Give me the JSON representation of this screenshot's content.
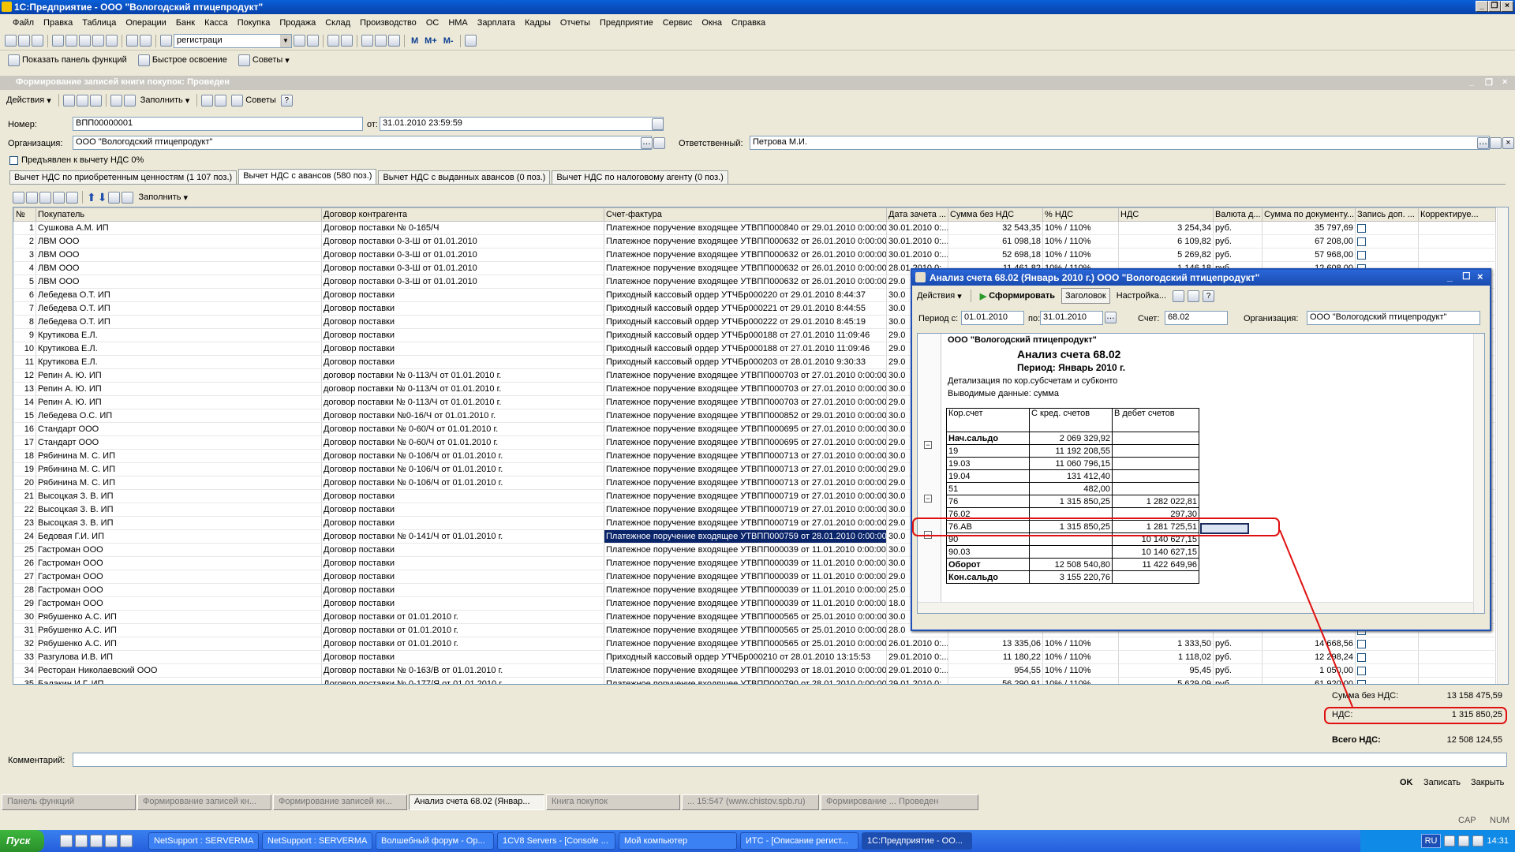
{
  "app": {
    "title": "1С:Предприятие - ООО \"Вологодский птицепродукт\""
  },
  "menu": [
    "Файл",
    "Правка",
    "Таблица",
    "Операции",
    "Банк",
    "Касса",
    "Покупка",
    "Продажа",
    "Склад",
    "Производство",
    "ОС",
    "НМА",
    "Зарплата",
    "Кадры",
    "Отчеты",
    "Предприятие",
    "Сервис",
    "Окна",
    "Справка"
  ],
  "toolbar": {
    "search_value": "регистраци"
  },
  "toolbar2": {
    "panel": "Показать панель функций",
    "quick": "Быстрое освоение",
    "tips": "Советы"
  },
  "doc": {
    "title": "Формирование записей книги покупок: Проведен",
    "actions": "Действия",
    "fill": "Заполнить",
    "tips": "Советы",
    "number_label": "Номер:",
    "number": "ВПП00000001",
    "date_label": "от:",
    "date": "31.01.2010 23:59:59",
    "org_label": "Организация:",
    "org": "ООО \"Вологодский птицепродукт\"",
    "resp_label": "Ответственный:",
    "resp": "Петрова М.И.",
    "checkbox_label": "Предъявлен к вычету НДС 0%",
    "tabs": [
      "Вычет НДС по приобретенным ценностям (1 107 поз.)",
      "Вычет НДС с авансов (580 поз.)",
      "Вычет НДС с выданных авансов (0 поз.)",
      "Вычет НДС по налоговому агенту (0 поз.)"
    ],
    "tab_fill": "Заполнить",
    "columns": [
      "№",
      "Покупатель",
      "Договор контрагента",
      "Счет-фактура",
      "Дата зачета ...",
      "Сумма без НДС",
      "% НДС",
      "НДС",
      "Валюта д...",
      "Сумма по документу...",
      "Запись доп. ...",
      "Корректируе..."
    ],
    "rows": [
      [
        "1",
        "Сушкова А.М. ИП",
        "Договор поставки № 0-165/Ч",
        "Платежное поручение входящее УТВПП000840 от 29.01.2010 0:00:00",
        "30.01.2010 0:...",
        "32 543,35",
        "10% / 110%",
        "3 254,34",
        "руб.",
        "35 797,69"
      ],
      [
        "2",
        "ЛВМ ООО",
        "Договор поставки 0-3-Ш от 01.01.2010",
        "Платежное поручение входящее УТВПП000632 от 26.01.2010 0:00:00",
        "30.01.2010 0:...",
        "61 098,18",
        "10% / 110%",
        "6 109,82",
        "руб.",
        "67 208,00"
      ],
      [
        "3",
        "ЛВМ ООО",
        "Договор поставки 0-3-Ш от 01.01.2010",
        "Платежное поручение входящее УТВПП000632 от 26.01.2010 0:00:00",
        "30.01.2010 0:...",
        "52 698,18",
        "10% / 110%",
        "5 269,82",
        "руб.",
        "57 968,00"
      ],
      [
        "4",
        "ЛВМ ООО",
        "Договор поставки 0-3-Ш от 01.01.2010",
        "Платежное поручение входящее УТВПП000632 от 26.01.2010 0:00:00",
        "28.01.2010 0:...",
        "11 461,82",
        "10% / 110%",
        "1 146,18",
        "руб.",
        "12 608,00"
      ],
      [
        "5",
        "ЛВМ ООО",
        "Договор поставки 0-3-Ш от 01.01.2010",
        "Платежное поручение входящее УТВПП000632 от 26.01.2010 0:00:00",
        "29.0",
        "",
        "",
        "",
        "",
        ""
      ],
      [
        "6",
        "Лебедева О.Т. ИП",
        "Договор поставки",
        "Приходный кассовый ордер УТЧБр000220 от 29.01.2010 8:44:37",
        "30.0",
        "",
        "",
        "",
        "",
        ""
      ],
      [
        "7",
        "Лебедева О.Т. ИП",
        "Договор поставки",
        "Приходный кассовый ордер УТЧБр000221 от 29.01.2010 8:44:55",
        "30.0",
        "",
        "",
        "",
        "",
        ""
      ],
      [
        "8",
        "Лебедева О.Т. ИП",
        "Договор поставки",
        "Приходный кассовый ордер УТЧБр000222 от 29.01.2010 8:45:19",
        "30.0",
        "",
        "",
        "",
        "",
        ""
      ],
      [
        "9",
        "Крутикова Е.Л.",
        "Договор поставки",
        "Приходный кассовый ордер УТЧБр000188 от 27.01.2010 11:09:46",
        "29.0",
        "",
        "",
        "",
        "",
        ""
      ],
      [
        "10",
        "Крутикова Е.Л.",
        "Договор поставки",
        "Приходный кассовый ордер УТЧБр000188 от 27.01.2010 11:09:46",
        "29.0",
        "",
        "",
        "",
        "",
        ""
      ],
      [
        "11",
        "Крутикова Е.Л.",
        "Договор поставки",
        "Приходный кассовый ордер УТЧБр000203 от 28.01.2010 9:30:33",
        "29.0",
        "",
        "",
        "",
        "",
        ""
      ],
      [
        "12",
        "Репин А. Ю. ИП",
        "договор поставки № 0-113/Ч от 01.01.2010 г.",
        "Платежное поручение входящее УТВПП000703 от 27.01.2010 0:00:00",
        "30.0",
        "",
        "",
        "",
        "",
        ""
      ],
      [
        "13",
        "Репин А. Ю. ИП",
        "договор поставки № 0-113/Ч от 01.01.2010 г.",
        "Платежное поручение входящее УТВПП000703 от 27.01.2010 0:00:00",
        "30.0",
        "",
        "",
        "",
        "",
        ""
      ],
      [
        "14",
        "Репин А. Ю. ИП",
        "договор поставки № 0-113/Ч от 01.01.2010 г.",
        "Платежное поручение входящее УТВПП000703 от 27.01.2010 0:00:00",
        "29.0",
        "",
        "",
        "",
        "",
        ""
      ],
      [
        "15",
        "Лебедева О.С. ИП",
        "Договор поставки №0-16/Ч от 01.01.2010 г.",
        "Платежное поручение входящее УТВПП000852 от 29.01.2010 0:00:00",
        "30.0",
        "",
        "",
        "",
        "",
        ""
      ],
      [
        "16",
        "Стандарт ООО",
        "Договор поставки № 0-60/Ч от 01.01.2010 г.",
        "Платежное поручение входящее УТВПП000695 от 27.01.2010 0:00:00",
        "30.0",
        "",
        "",
        "",
        "",
        ""
      ],
      [
        "17",
        "Стандарт ООО",
        "Договор поставки № 0-60/Ч от 01.01.2010 г.",
        "Платежное поручение входящее УТВПП000695 от 27.01.2010 0:00:00",
        "29.0",
        "",
        "",
        "",
        "",
        ""
      ],
      [
        "18",
        "Рябинина М. С. ИП",
        "Договор поставки № 0-106/Ч от 01.01.2010 г.",
        "Платежное поручение входящее УТВПП000713 от 27.01.2010 0:00:00",
        "30.0",
        "",
        "",
        "",
        "",
        ""
      ],
      [
        "19",
        "Рябинина М. С. ИП",
        "Договор поставки № 0-106/Ч от 01.01.2010 г.",
        "Платежное поручение входящее УТВПП000713 от 27.01.2010 0:00:00",
        "29.0",
        "",
        "",
        "",
        "",
        ""
      ],
      [
        "20",
        "Рябинина М. С. ИП",
        "Договор поставки № 0-106/Ч от 01.01.2010 г.",
        "Платежное поручение входящее УТВПП000713 от 27.01.2010 0:00:00",
        "29.0",
        "",
        "",
        "",
        "",
        ""
      ],
      [
        "21",
        "Высоцкая З. В. ИП",
        "Договор поставки",
        "Платежное поручение входящее УТВПП000719 от 27.01.2010 0:00:00",
        "30.0",
        "",
        "",
        "",
        "",
        ""
      ],
      [
        "22",
        "Высоцкая З. В. ИП",
        "Договор поставки",
        "Платежное поручение входящее УТВПП000719 от 27.01.2010 0:00:00",
        "30.0",
        "",
        "",
        "",
        "",
        ""
      ],
      [
        "23",
        "Высоцкая З. В. ИП",
        "Договор поставки",
        "Платежное поручение входящее УТВПП000719 от 27.01.2010 0:00:00",
        "29.0",
        "",
        "",
        "",
        "",
        ""
      ],
      [
        "24",
        "Бедовая Г.И. ИП",
        "Договор поставки № 0-141/Ч от 01.01.2010 г.",
        "Платежное поручение входящее УТВПП000759 от 28.01.2010 0:00:00",
        "30.0",
        "",
        "",
        "",
        "",
        ""
      ],
      [
        "25",
        "Гастроман ООО",
        "Договор поставки",
        "Платежное поручение входящее УТВПП000039 от 11.01.2010 0:00:00",
        "30.0",
        "",
        "",
        "",
        "",
        ""
      ],
      [
        "26",
        "Гастроман ООО",
        "Договор поставки",
        "Платежное поручение входящее УТВПП000039 от 11.01.2010 0:00:00",
        "30.0",
        "",
        "",
        "",
        "",
        ""
      ],
      [
        "27",
        "Гастроман ООО",
        "Договор поставки",
        "Платежное поручение входящее УТВПП000039 от 11.01.2010 0:00:00",
        "29.0",
        "",
        "",
        "",
        "",
        ""
      ],
      [
        "28",
        "Гастроман ООО",
        "Договор поставки",
        "Платежное поручение входящее УТВПП000039 от 11.01.2010 0:00:00",
        "25.0",
        "",
        "",
        "",
        "",
        ""
      ],
      [
        "29",
        "Гастроман ООО",
        "Договор поставки",
        "Платежное поручение входящее УТВПП000039 от 11.01.2010 0:00:00",
        "18.0",
        "",
        "",
        "",
        "",
        ""
      ],
      [
        "30",
        "Рябушенко А.С. ИП",
        "Договор поставки от 01.01.2010 г.",
        "Платежное поручение входящее УТВПП000565 от 25.01.2010 0:00:00",
        "30.0",
        "",
        "",
        "",
        "",
        ""
      ],
      [
        "31",
        "Рябушенко А.С. ИП",
        "Договор поставки от 01.01.2010 г.",
        "Платежное поручение входящее УТВПП000565 от 25.01.2010 0:00:00",
        "28.0",
        "",
        "",
        "",
        "",
        ""
      ],
      [
        "32",
        "Рябушенко А.С. ИП",
        "Договор поставки от 01.01.2010 г.",
        "Платежное поручение входящее УТВПП000565 от 25.01.2010 0:00:00",
        "26.01.2010 0:...",
        "13 335,06",
        "10% / 110%",
        "1 333,50",
        "руб.",
        "14 668,56"
      ],
      [
        "33",
        "Разгулова И.В. ИП",
        "Договор поставки",
        "Приходный кассовый ордер УТЧБр000210 от 28.01.2010 13:15:53",
        "29.01.2010 0:...",
        "11 180,22",
        "10% / 110%",
        "1 118,02",
        "руб.",
        "12 298,24"
      ],
      [
        "34",
        "Ресторан Николаевский ООО",
        "Договор поставки № 0-163/В от 01.01.2010 г.",
        "Платежное поручение входящее УТВПП000293 от 18.01.2010 0:00:00",
        "29.01.2010 0:...",
        "954,55",
        "10% / 110%",
        "95,45",
        "руб.",
        "1 050,00"
      ],
      [
        "35",
        "Балакин И.Г. ИП",
        "Договор поставки № 0-177/Я от 01.01.2010 г.",
        "Платежное поручение входящее УТВПП000790 от 28.01.2010 0:00:00",
        "29.01.2010 0:...",
        "56 290,91",
        "10% / 110%",
        "5 629,09",
        "руб.",
        "61 920,00"
      ]
    ],
    "summary": {
      "sum_label": "Сумма без НДС:",
      "sum": "13 158 475,59",
      "vat_label": "НДС:",
      "vat": "1 315 850,25",
      "total_label": "Всего НДС:",
      "total": "12 508 124,55"
    },
    "comment_label": "Комментарий:",
    "ok": "OK",
    "save": "Записать",
    "close": "Закрыть"
  },
  "analysis": {
    "title": "Анализ счета 68.02 (Январь 2010 г.) ООО \"Вологодский птицепродукт\"",
    "actions": "Действия",
    "generate": "Сформировать",
    "header_btn": "Заголовок",
    "settings": "Настройка...",
    "period_label": "Период с:",
    "from": "01.01.2010",
    "to_label": "по:",
    "to": "31.01.2010",
    "account_label": "Счет:",
    "account": "68.02",
    "org_label": "Организация:",
    "org": "ООО \"Вологодский птицепродукт\"",
    "report": {
      "org": "ООО \"Вологодский птицепродукт\"",
      "title": "Анализ счета 68.02",
      "period": "Период: Январь 2010 г.",
      "detail": "Детализация по  кор.субсчетам и субконто",
      "output": "Выводимые данные: сумма",
      "headers": [
        "Кор.счет",
        "С кред. счетов",
        "В дебет счетов"
      ],
      "rows": [
        [
          "Нач.сальдо",
          "2 069 329,92",
          ""
        ],
        [
          "19",
          "11 192 208,55",
          ""
        ],
        [
          "19.03",
          "11 060 796,15",
          ""
        ],
        [
          "19.04",
          "131 412,40",
          ""
        ],
        [
          "51",
          "482,00",
          ""
        ],
        [
          "76",
          "1 315 850,25",
          "1 282 022,81"
        ],
        [
          "76.02",
          "",
          "297,30"
        ],
        [
          "76.АВ",
          "1 315 850,25",
          "1 281 725,51"
        ],
        [
          "90",
          "",
          "10 140 627,15"
        ],
        [
          "90.03",
          "",
          "10 140 627,15"
        ],
        [
          "Оборот",
          "12 508 540,80",
          "11 422 649,96"
        ],
        [
          "Кон.сальдо",
          "3 155 220,76",
          ""
        ]
      ]
    }
  },
  "window_tabs": [
    "Панель функций",
    "Формирование записей кн...",
    "Формирование записей кн...",
    "Анализ счета 68.02 (Январ...",
    "Книга покупок",
    "... 15:547 (www.chistov.spb.ru)",
    "Формирование ... Проведен"
  ],
  "status": {
    "cap": "CAP",
    "num": "NUM"
  },
  "taskbar": {
    "start": "Пуск",
    "items": [
      "NetSupport : SERVERMA",
      "NetSupport : SERVERMA",
      "Волшебный форум - Ор...",
      "1CV8 Servers - [Console ...",
      "Мой компьютер",
      "ИТС - [Описание регист...",
      "1С:Предприятие - ОО..."
    ],
    "lang": "RU",
    "time": "14:31"
  }
}
